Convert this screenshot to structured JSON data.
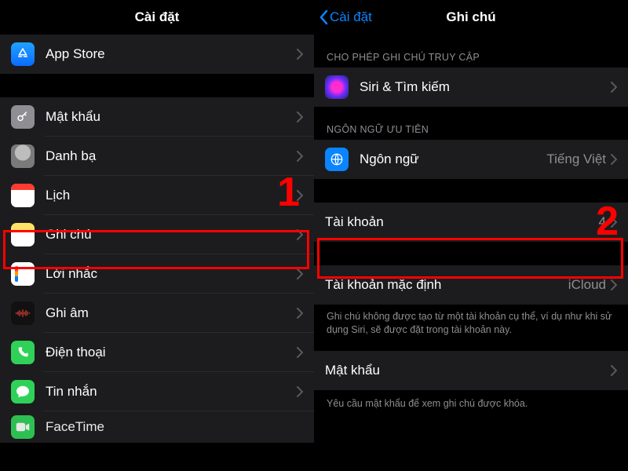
{
  "left": {
    "title": "Cài đặt",
    "items": [
      {
        "key": "appstore",
        "label": "App Store"
      },
      {
        "key": "passwords",
        "label": "Mật khẩu"
      },
      {
        "key": "contacts",
        "label": "Danh bạ"
      },
      {
        "key": "calendar",
        "label": "Lịch"
      },
      {
        "key": "notes",
        "label": "Ghi chú"
      },
      {
        "key": "reminders",
        "label": "Lời nhắc"
      },
      {
        "key": "voicememos",
        "label": "Ghi âm"
      },
      {
        "key": "phone",
        "label": "Điện thoại"
      },
      {
        "key": "messages",
        "label": "Tin nhắn"
      },
      {
        "key": "facetime",
        "label": "FaceTime"
      }
    ],
    "annotation": "1"
  },
  "right": {
    "back": "Cài đặt",
    "title": "Ghi chú",
    "section_access": "CHO PHÉP GHI CHÚ TRUY CẬP",
    "siri": "Siri & Tìm kiếm",
    "section_lang": "NGÔN NGỮ ƯU TIÊN",
    "lang_label": "Ngôn ngữ",
    "lang_value": "Tiếng Việt",
    "accounts_label": "Tài khoản",
    "accounts_value": "4",
    "default_acc_label": "Tài khoản mặc định",
    "default_acc_value": "iCloud",
    "default_note": "Ghi chú không được tạo từ một tài khoản cụ thể, ví dụ như khi sử dụng Siri, sẽ được đặt trong tài khoản này.",
    "password_label": "Mật khẩu",
    "password_hint": "Yêu cầu mật khẩu để xem ghi chú được khóa.",
    "annotation": "2"
  }
}
